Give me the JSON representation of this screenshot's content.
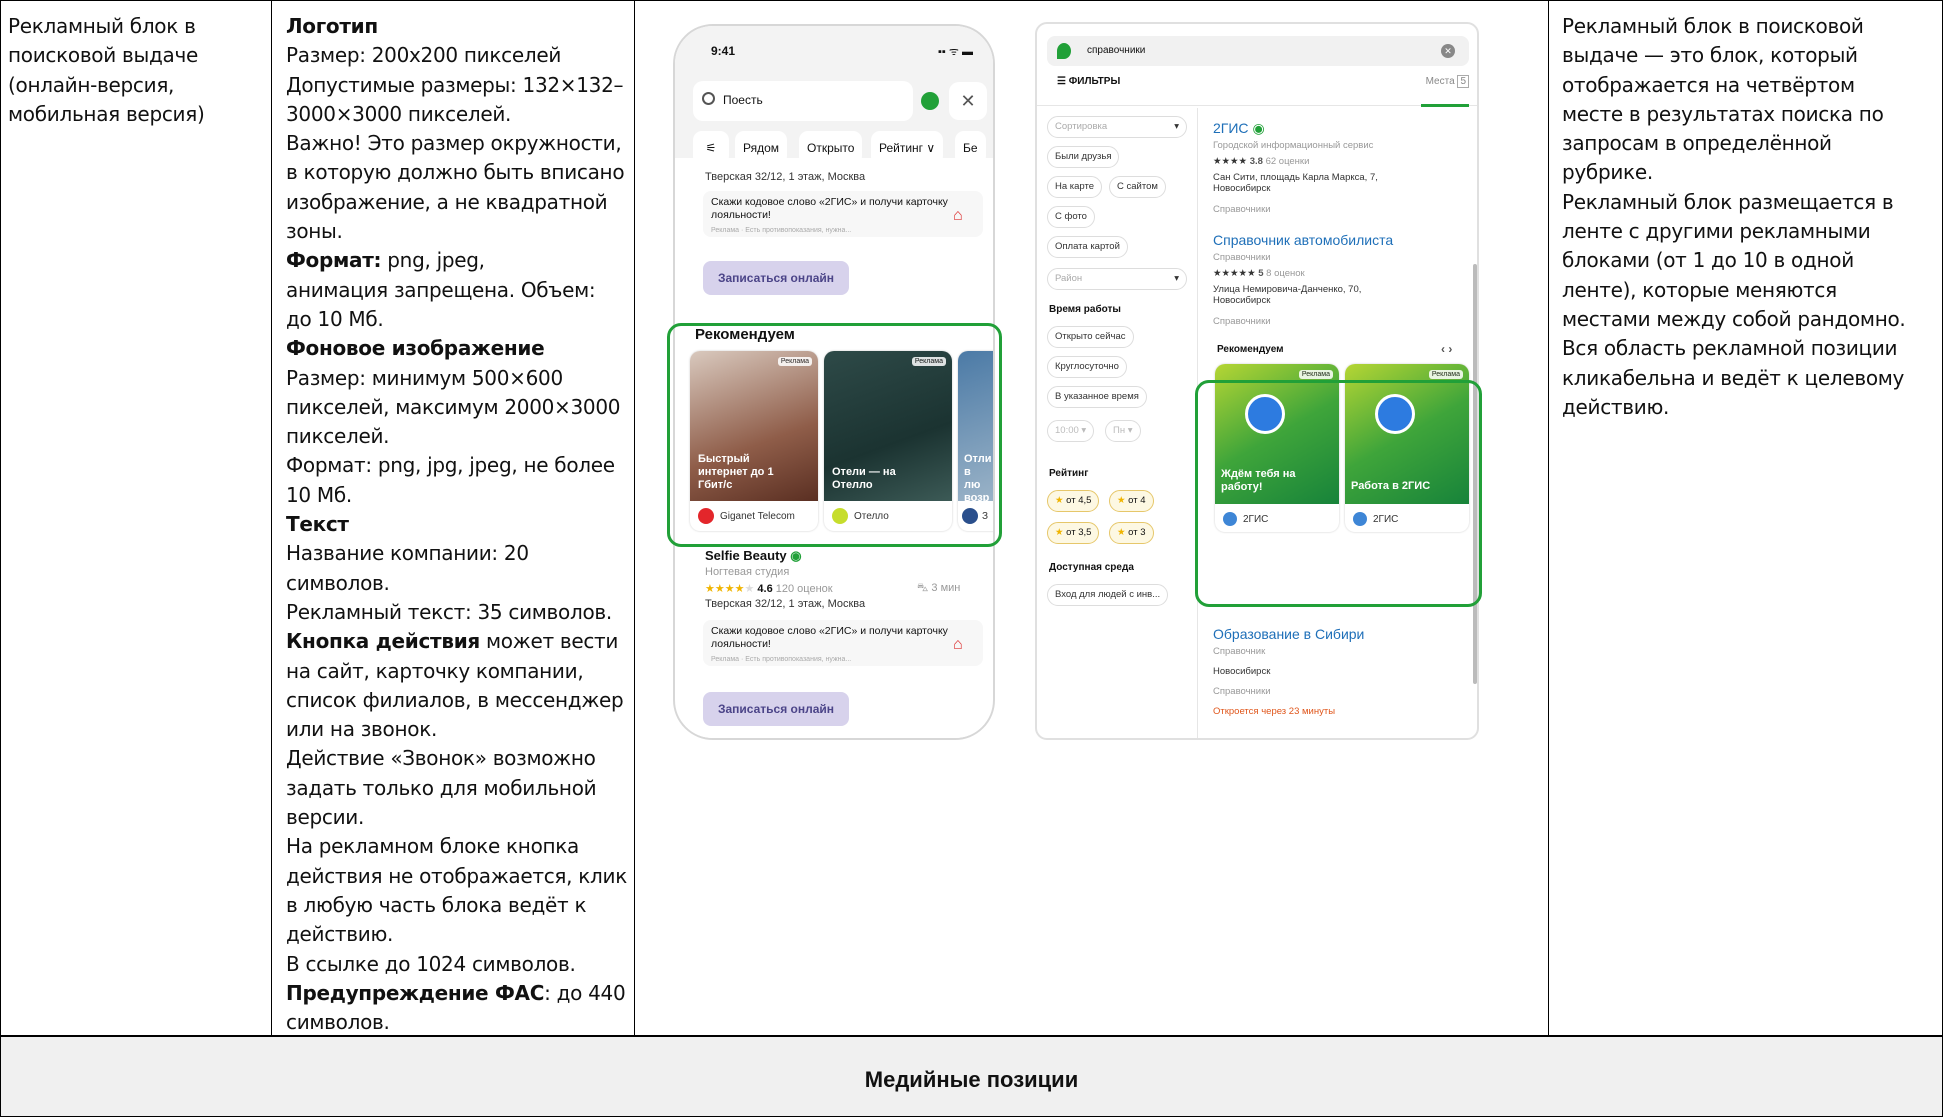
{
  "col1": {
    "lines": [
      "Рекламный блок в",
      "поисковой выдаче",
      "(онлайн-версия,",
      "мобильная версия)"
    ]
  },
  "col2": {
    "lines": [
      {
        "parts": [
          {
            "text": "Логотип",
            "bold": true
          }
        ]
      },
      {
        "parts": [
          {
            "text": "Размер: 200x200 пикселей",
            "bold": false
          }
        ]
      },
      {
        "parts": [
          {
            "text": "Допустимые размеры: 132×132–",
            "bold": false
          }
        ]
      },
      {
        "parts": [
          {
            "text": "3000×3000 пикселей.",
            "bold": false
          }
        ]
      },
      {
        "parts": [
          {
            "text": "Важно! Это размер окружности,",
            "bold": false
          }
        ]
      },
      {
        "parts": [
          {
            "text": "в которую должно быть вписано",
            "bold": false
          }
        ]
      },
      {
        "parts": [
          {
            "text": "изображение, а не квадратной",
            "bold": false
          }
        ]
      },
      {
        "parts": [
          {
            "text": "зоны.",
            "bold": false
          }
        ]
      },
      {
        "parts": [
          {
            "text": "Формат:",
            "bold": true
          },
          {
            "text": " png, jpeg,",
            "bold": false
          }
        ]
      },
      {
        "parts": [
          {
            "text": "анимация запрещена. Объем:",
            "bold": false
          }
        ]
      },
      {
        "parts": [
          {
            "text": "до 10 Мб.",
            "bold": false
          }
        ]
      },
      {
        "parts": [
          {
            "text": "Фоновое изображение",
            "bold": true
          }
        ]
      },
      {
        "parts": [
          {
            "text": "Размер: минимум 500×600",
            "bold": false
          }
        ]
      },
      {
        "parts": [
          {
            "text": "пикселей, максимум 2000×3000",
            "bold": false
          }
        ]
      },
      {
        "parts": [
          {
            "text": "пикселей.",
            "bold": false
          }
        ]
      },
      {
        "parts": [
          {
            "text": "Формат: png, jpg, jpeg, не более",
            "bold": false
          }
        ]
      },
      {
        "parts": [
          {
            "text": "10 Мб.",
            "bold": false
          }
        ]
      },
      {
        "parts": [
          {
            "text": "Текст",
            "bold": true
          }
        ]
      },
      {
        "parts": [
          {
            "text": "Название компании: 20",
            "bold": false
          }
        ]
      },
      {
        "parts": [
          {
            "text": "символов.",
            "bold": false
          }
        ]
      },
      {
        "parts": [
          {
            "text": "Рекламный текст: 35 символов.",
            "bold": false
          }
        ]
      },
      {
        "parts": [
          {
            "text": "Кнопка действия",
            "bold": true
          },
          {
            "text": " может вести",
            "bold": false
          }
        ]
      },
      {
        "parts": [
          {
            "text": "на сайт, карточку компании,",
            "bold": false
          }
        ]
      },
      {
        "parts": [
          {
            "text": "список филиалов, в мессенджер",
            "bold": false
          }
        ]
      },
      {
        "parts": [
          {
            "text": "или на звонок.",
            "bold": false
          }
        ]
      },
      {
        "parts": [
          {
            "text": "Действие «Звонок» возможно",
            "bold": false
          }
        ]
      },
      {
        "parts": [
          {
            "text": "задать только для мобильной",
            "bold": false
          }
        ]
      },
      {
        "parts": [
          {
            "text": "версии.",
            "bold": false
          }
        ]
      },
      {
        "parts": [
          {
            "text": "На рекламном блоке кнопка",
            "bold": false
          }
        ]
      },
      {
        "parts": [
          {
            "text": "действия не отображается, клик",
            "bold": false
          }
        ]
      },
      {
        "parts": [
          {
            "text": "в любую часть блока ведёт к",
            "bold": false
          }
        ]
      },
      {
        "parts": [
          {
            "text": "действию.",
            "bold": false
          }
        ]
      },
      {
        "parts": [
          {
            "text": "В ссылке до 1024 символов.",
            "bold": false
          }
        ]
      },
      {
        "parts": [
          {
            "text": "Предупреждение ФАС",
            "bold": true
          },
          {
            "text": ": до 440",
            "bold": false
          }
        ]
      },
      {
        "parts": [
          {
            "text": "символов.",
            "bold": false
          }
        ]
      }
    ]
  },
  "col4": {
    "lines": [
      "Рекламный блок в поисковой",
      "выдаче — это блок, который",
      "отображается на четвёртом",
      "месте в результатах поиска по",
      "запросам в определённой",
      "рубрике.",
      "Рекламный блок размещается в",
      "ленте с другими рекламными",
      "блоками (от 1 до 10 в одной",
      "ленте), которые меняются",
      "местами между собой рандомно.",
      "Вся область рекламной позиции",
      "кликабельна и ведёт к целевому",
      "действию."
    ]
  },
  "media_title": "Медийные позиции",
  "phone": {
    "time": "9:41",
    "status_icons": "▪▪ ᯤ ▬",
    "search_placeholder": "Поесть",
    "close": "✕",
    "chips": [
      "Рядом",
      "Открыто",
      "Рейтинг ∨",
      "Бе"
    ],
    "address1": "Тверская 32/12, 1 этаж, Москва",
    "promo1": "Скажи кодовое слово «2ГИС» и получи карточку лояльности!",
    "promo_small": "Реклама · Есть противопоказания, нужна...",
    "button1": "Записаться онлайн",
    "rec_title": "Рекомендуем",
    "ad_tag": "Реклама",
    "rec_cards": [
      {
        "text": "Быстрый интернет до 1 Гбит/с",
        "brand": "Giganet Telecom"
      },
      {
        "text": "Отели — на Отелло",
        "brand": "Отелло"
      },
      {
        "text": "Отли в лю возр",
        "brand": "З"
      }
    ],
    "company": "Selfie Beauty",
    "company_type": "Ногтевая студия",
    "rating": "4.6",
    "reviews": "120 оценок",
    "distance": "3 мин",
    "address2": "Тверская 32/12, 1 этаж, Москва",
    "promo2": "Скажи кодовое слово «2ГИС» и получи карточку лояльности!",
    "button2": "Записаться онлайн"
  },
  "desktop": {
    "search": "справочники",
    "filters": "ФИЛЬТРЫ",
    "places": "Места",
    "places_count": "5",
    "sort": "Сортировка",
    "pills": [
      "Были друзья",
      "На карте",
      "С сайтом",
      "С фото",
      "Оплата картой"
    ],
    "district": "Район",
    "work_time": "Время работы",
    "work_pills": [
      "Открыто сейчас",
      "Круглосуточно",
      "В указанное время"
    ],
    "time_from": "10:00",
    "day": "Пн",
    "rating_title": "Рейтинг",
    "rating_pills": [
      "от 4,5",
      "от 4",
      "от 3,5",
      "от 3"
    ],
    "access_title": "Доступная среда",
    "access_pill": "Вход для людей с инв...",
    "r1_title": "2ГИС",
    "r1_sub": "Городской информационный сервис",
    "r1_rating": "3.8",
    "r1_reviews": "62 оценки",
    "r1_addr": "Сан Сити, площадь Карла Маркса, 7, Новосибирск",
    "r1_cat": "Справочники",
    "r2_title": "Справочник автомобилиста",
    "r2_sub": "Справочники",
    "r2_rating": "5",
    "r2_reviews": "8 оценок",
    "r2_addr": "Улица Немировича-Данченко, 70, Новосибирск",
    "r2_cat": "Справочники",
    "rec_title": "Рекомендуем",
    "rec_nav": "‹  ›",
    "ad_tag": "Реклама",
    "rec_cards": [
      {
        "text": "Ждём тебя на работу!",
        "brand": "2ГИС"
      },
      {
        "text": "Работа в 2ГИС",
        "brand": "2ГИС"
      }
    ],
    "r3_title": "Образование в Сибири",
    "r3_sub": "Справочник",
    "r3_city": "Новосибирск",
    "r3_cat": "Справочники",
    "r3_open": "Откроется через 23 минуты"
  },
  "colors": {
    "accent": "#21a038",
    "link": "#1e6fb8",
    "button_bg": "#d7d2ec"
  }
}
